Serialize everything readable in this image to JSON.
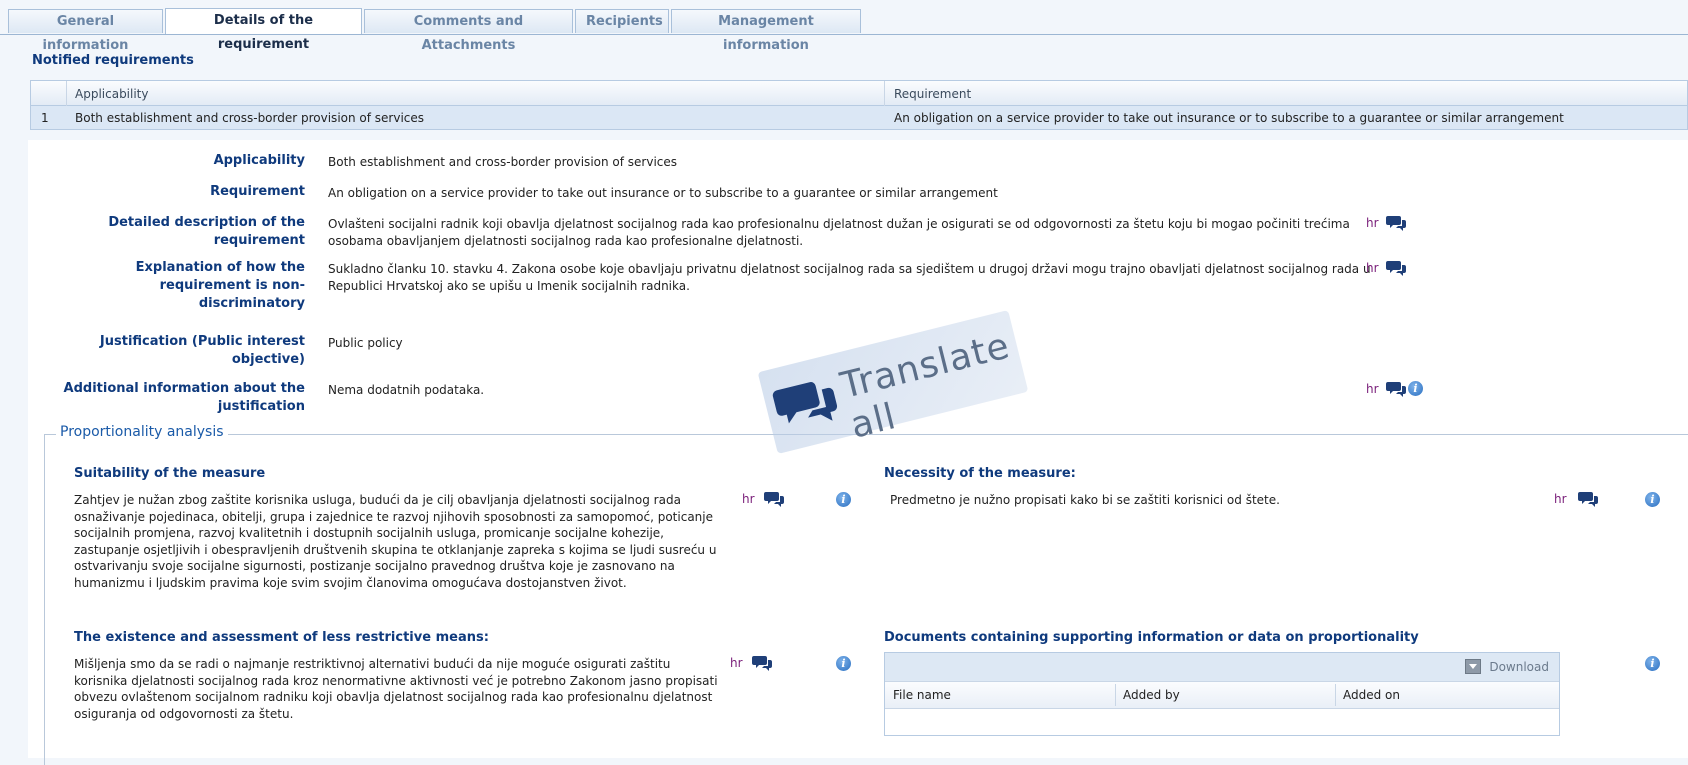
{
  "tabs": [
    {
      "label": "General information"
    },
    {
      "label": "Details of the requirement"
    },
    {
      "label": "Comments and Attachments"
    },
    {
      "label": "Recipients"
    },
    {
      "label": "Management information"
    }
  ],
  "section_title": "Notified requirements",
  "grid": {
    "columns": [
      "Applicability",
      "Requirement"
    ],
    "rows": [
      {
        "index": "1",
        "applicability": "Both establishment and cross-border provision of services",
        "requirement": "An obligation on a service provider to take out insurance or to subscribe to a guarantee or similar arrangement"
      }
    ]
  },
  "details": {
    "applicability": {
      "label": "Applicability",
      "value": "Both establishment and cross-border provision of services"
    },
    "requirement": {
      "label": "Requirement",
      "value": "An obligation on a service provider to take out insurance or to subscribe to a guarantee or similar arrangement"
    },
    "detailed_description": {
      "label_line1": "Detailed description of the",
      "label_line2": "requirement",
      "value": "Ovlašteni socijalni radnik koji obavlja djelatnost socijalnog rada kao profesionalnu djelatnost dužan je osigurati se od odgovornosti za štetu koju bi mogao počiniti trećima osobama obavljanjem djelatnosti socijalnog rada kao profesionalne djelatnosti.",
      "lang": "hr"
    },
    "explanation": {
      "label_line1": "Explanation of how the",
      "label_line2": "requirement is non-",
      "label_line3": "discriminatory",
      "value": "Sukladno članku 10. stavku 4. Zakona osobe koje obavljaju privatnu djelatnost socijalnog rada sa sjedištem u drugoj državi mogu trajno obavljati djelatnost socijalnog rada u Republici Hrvatskoj ako se upišu u Imenik socijalnih radnika.",
      "lang": "hr"
    },
    "justification": {
      "label_line1": "Justification (Public interest",
      "label_line2": "objective)",
      "value": "Public policy"
    },
    "additional_info": {
      "label_line1": "Additional information about the",
      "label_line2": "justification",
      "value": "Nema dodatnih podataka.",
      "lang": "hr"
    }
  },
  "proportionality": {
    "legend": "Proportionality analysis",
    "suitability": {
      "title": "Suitability of the measure",
      "text": "Zahtjev je nužan zbog zaštite korisnika usluga, budući da je cilj obavljanja djelatnosti socijalnog rada osnaživanje pojedinaca, obitelji, grupa i zajednice te razvoj njihovih sposobnosti za samopomoć, poticanje socijalnih promjena, razvoj kvalitetnih i dostupnih socijalnih usluga, promicanje socijalne kohezije, zastupanje osjetljivih i obespravljenih društvenih skupina te otklanjanje zapreka s kojima se ljudi susreću u ostvarivanju svoje socijalne sigurnosti, postizanje socijalno pravednog društva koje je zasnovano na humanizmu i ljudskim pravima koje svim svojim članovima omogućava dostojanstven život.",
      "lang": "hr"
    },
    "necessity": {
      "title": "Necessity of the measure:",
      "text": "Predmetno je nužno propisati kako bi se zaštiti korisnici od štete.",
      "lang": "hr"
    },
    "less_restrictive": {
      "title": "The existence and assessment of less restrictive means:",
      "text": "Mišljenja smo da se radi o najmanje restriktivnoj alternativi budući da nije moguće osigurati zaštitu korisnika djelatnosti socijalnog rada kroz nenormativne aktivnosti već je potrebno Zakonom jasno propisati obvezu ovlaštenom socijalnom radniku koji obavlja djelatnost socijalnog rada kao profesionalnu djelatnost osiguranja od odgovornosti za štetu.",
      "lang": "hr"
    },
    "documents": {
      "title": "Documents containing supporting information or data on proportionality",
      "download_label": "Download",
      "columns": [
        "File name",
        "Added by",
        "Added on"
      ]
    }
  },
  "translate_stamp": {
    "label": "Translate all"
  },
  "icons": {
    "comment": "chat-bubbles-icon",
    "info": "info-icon",
    "download": "download-icon"
  },
  "colors": {
    "label_blue": "#0f3a7d",
    "lang_purple": "#7a1f7a",
    "row_selected": "#dbe7f5"
  }
}
